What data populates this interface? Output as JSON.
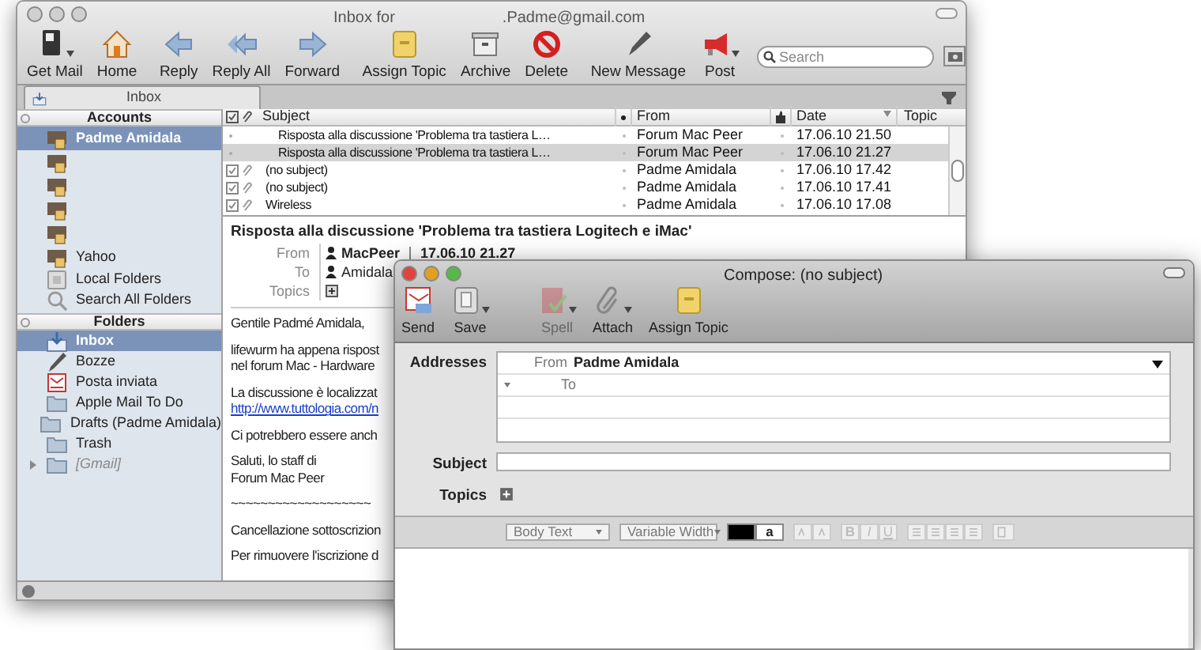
{
  "main_window": {
    "active": false,
    "title_prefix": "Inbox for",
    "title_suffix": ".Padme@gmail.com",
    "toolbar": [
      {
        "label": "Get Mail",
        "kind": "getmail",
        "menu": true
      },
      {
        "label": "Home",
        "kind": "home"
      },
      {
        "label": "Reply",
        "kind": "reply"
      },
      {
        "label": "Reply All",
        "kind": "replyall"
      },
      {
        "label": "Forward",
        "kind": "forward"
      },
      {
        "label": "Assign Topic",
        "kind": "topic"
      },
      {
        "label": "Archive",
        "kind": "archive"
      },
      {
        "label": "Delete",
        "kind": "delete"
      },
      {
        "label": "New Message",
        "kind": "pen"
      },
      {
        "label": "Post",
        "kind": "megaphone",
        "menu": true
      }
    ],
    "search": {
      "placeholder": "Search"
    },
    "tab": {
      "label": "Inbox"
    },
    "sidebar": {
      "accounts_header": "Accounts",
      "accounts": [
        {
          "name": "Padme Amidala",
          "kind": "account",
          "selected": true
        },
        {
          "kind": "account",
          "selected": false
        },
        {
          "kind": "account",
          "selected": false
        },
        {
          "kind": "account",
          "selected": false
        },
        {
          "kind": "account",
          "selected": false
        },
        {
          "name": "Yahoo",
          "kind": "account",
          "selected": false
        },
        {
          "name": "Local Folders",
          "kind": "local",
          "selected": false
        },
        {
          "name": "Search All Folders",
          "kind": "search",
          "selected": false
        }
      ],
      "folders_header": "Folders",
      "folders": [
        {
          "name": "Inbox",
          "kind": "inbox",
          "selected": true
        },
        {
          "name": "Bozze",
          "kind": "drafts",
          "selected": false
        },
        {
          "name": "Posta inviata",
          "kind": "sent",
          "selected": false
        },
        {
          "name": "Apple Mail To Do",
          "kind": "folder",
          "selected": false
        },
        {
          "name": "Drafts (Padme Amidala)",
          "kind": "folder",
          "selected": false
        },
        {
          "name": "Trash",
          "kind": "folder",
          "selected": false
        },
        {
          "name": "[Gmail]",
          "kind": "virtual",
          "selected": false,
          "expanded": false
        }
      ]
    },
    "message_list": {
      "columns": [
        "Subject",
        "From",
        "Date",
        "Topic"
      ],
      "rows": [
        {
          "subject": "Risposta alla discussione 'Problema tra tastiera L…",
          "from": "Forum Mac Peer",
          "date": "17.06.10 21.50",
          "kind": "received",
          "selected": false
        },
        {
          "subject": "Risposta alla discussione 'Problema tra tastiera L…",
          "from": "Forum Mac Peer",
          "date": "17.06.10 21.27",
          "kind": "received",
          "selected": true
        },
        {
          "subject": "(no subject)",
          "from": "Padme Amidala",
          "date": "17.06.10 17.42",
          "kind": "sent",
          "selected": false
        },
        {
          "subject": "(no subject)",
          "from": "Padme Amidala",
          "date": "17.06.10 17.41",
          "kind": "sent",
          "selected": false
        },
        {
          "subject": "Wireless",
          "from": "Padme Amidala",
          "date": "17.06.10 17.08",
          "kind": "sent",
          "selected": false
        }
      ]
    },
    "preview": {
      "subject": "Risposta alla discussione 'Problema tra tastiera Logitech e iMac'",
      "from_label": "From",
      "from": "MacPeer",
      "date": "17.06.10 21.27",
      "to_label": "To",
      "to": "Amidala",
      "topics_label": "Topics",
      "paragraphs": [
        [
          {
            "text": "Gentile Padmé Amidala,",
            "kind": "text"
          }
        ],
        [
          {
            "text": "lifewurm ha appena rispost",
            "kind": "text"
          },
          {
            "text": "nel forum Mac - Hardware",
            "kind": "text"
          }
        ],
        [
          {
            "text": "La discussione è localizzat",
            "kind": "text"
          },
          {
            "text": "http://www.tuttologia.com/n",
            "kind": "link"
          }
        ],
        [
          {
            "text": "Ci potrebbero essere anch",
            "kind": "text"
          }
        ],
        [
          {
            "text": "Saluti, lo staff di",
            "kind": "text"
          },
          {
            "text": "Forum Mac Peer",
            "kind": "text"
          }
        ],
        [
          {
            "text": "~~~~~~~~~~~~~~~~~~~",
            "kind": "text"
          }
        ],
        [
          {
            "text": "Cancellazione sottoscrizion",
            "kind": "text"
          }
        ],
        [
          {
            "text": "Per rimuovere l'iscrizione d",
            "kind": "text"
          }
        ]
      ]
    }
  },
  "compose_window": {
    "active": true,
    "title": "Compose: (no subject)",
    "toolbar": [
      {
        "label": "Send",
        "kind": "send",
        "disabled": false
      },
      {
        "label": "Save",
        "kind": "save",
        "menu": true,
        "disabled": false
      },
      {
        "label": "Spell",
        "kind": "spell",
        "menu": true,
        "disabled": true
      },
      {
        "label": "Attach",
        "kind": "attach",
        "menu": true,
        "disabled": false
      },
      {
        "label": "Assign Topic",
        "kind": "topic",
        "disabled": false
      }
    ],
    "addresses_label": "Addresses",
    "from_label": "From",
    "from_value": "Padme Amidala",
    "to_label": "To",
    "subject_label": "Subject",
    "topics_label": "Topics",
    "format": {
      "paragraph_style": "Body Text",
      "font": "Variable Width",
      "highlight_letter": "a",
      "style_buttons": [
        "B",
        "I",
        "U"
      ]
    }
  }
}
